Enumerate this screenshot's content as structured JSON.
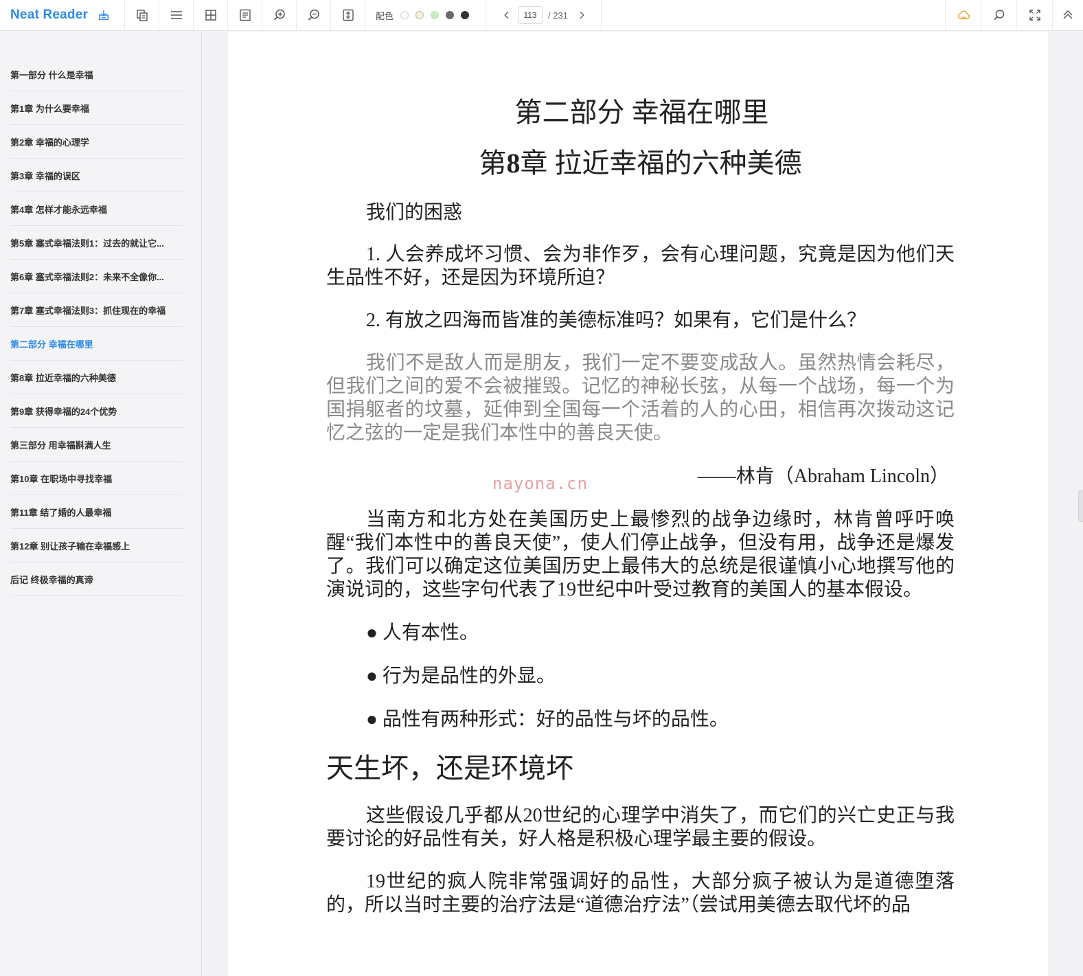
{
  "app": {
    "name": "Neat Reader"
  },
  "toolbar": {
    "color_label": "配色",
    "swatches": [
      "#ffffff",
      "#f5f0dc",
      "#c9ecc6",
      "#6a6a6a",
      "#333333"
    ],
    "page_current": "113",
    "page_total": "/ 231"
  },
  "toc": [
    "第一部分 什么是幸福",
    "第1章 为什么要幸福",
    "第2章 幸福的心理学",
    "第3章 幸福的误区",
    "第4章 怎样才能永远幸福",
    "第5章 塞式幸福法则1：过去的就让它...",
    "第6章 塞式幸福法则2：未来不全像你...",
    "第7章 塞式幸福法则3：抓住现在的幸福",
    "第二部分 幸福在哪里",
    "第8章 拉近幸福的六种美德",
    "第9章 获得幸福的24个优势",
    "第三部分 用幸福斟满人生",
    "第10章 在职场中寻找幸福",
    "第11章 结了婚的人最幸福",
    "第12章 别让孩子输在幸福感上",
    "后记 终极幸福的真谛"
  ],
  "toc_active_index": 8,
  "content": {
    "part_title": "第二部分 幸福在哪里",
    "chapter_prefix": "第",
    "chapter_number": "8",
    "chapter_suffix": "章 拉近幸福的六种美德",
    "subhead": "我们的困惑",
    "q1": "1. 人会养成坏习惯、会为非作歹，会有心理问题，究竟是因为他们天生品性不好，还是因为环境所迫？",
    "q2": "2. 有放之四海而皆准的美德标准吗？如果有，它们是什么？",
    "quote": "我们不是敌人而是朋友，我们一定不要变成敌人。虽然热情会耗尽，但我们之间的爱不会被摧毁。记忆的神秘长弦，从每一个战场，每一个为国捐躯者的坟墓，延伸到全国每一个活着的人的心田，相信再次拨动这记忆之弦的一定是我们本性中的善良天使。",
    "attribution": "——林肯（Abraham Lincoln）",
    "para1": "当南方和北方处在美国历史上最惨烈的战争边缘时，林肯曾呼吁唤醒“我们本性中的善良天使”，使人们停止战争，但没有用，战争还是爆发了。我们可以确定这位美国历史上最伟大的总统是很谨慎小心地撰写他的演说词的，这些字句代表了19世纪中叶受过教育的美国人的基本假设。",
    "bullets": [
      "● 人有本性。",
      "● 行为是品性的外显。",
      "● 品性有两种形式：好的品性与坏的品性。"
    ],
    "section_title": "天生坏，还是环境坏",
    "para2": "这些假设几乎都从20世纪的心理学中消失了，而它们的兴亡史正与我要讨论的好品性有关，好人格是积极心理学最主要的假设。",
    "para3": "19世纪的疯人院非常强调好的品性，大部分疯子被认为是道德堕落的，所以当时主要的治疗法是“道德治疗法”（尝试用美德去取代坏的品"
  },
  "watermark": "nayona.cn"
}
